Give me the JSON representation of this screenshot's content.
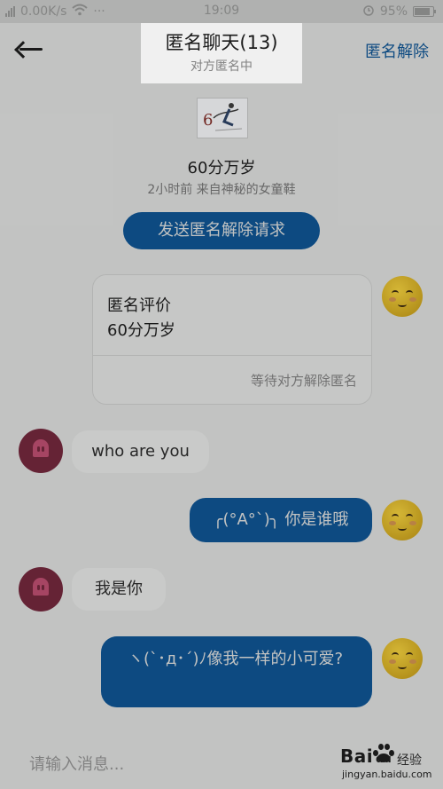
{
  "status_bar": {
    "network_speed": "0.00K/s",
    "time": "19:09",
    "battery_percent": "95%",
    "battery_level": 0.95,
    "more_dots": "···"
  },
  "header": {
    "title": "匿名聊天(13)",
    "subtitle": "对方匿名中",
    "right_action": "匿名解除"
  },
  "profile": {
    "name": "60分万岁",
    "meta": "2小时前  来自神秘的女童鞋",
    "image_text": "6"
  },
  "request_button": "发送匿名解除请求",
  "card": {
    "line1": "匿名评价",
    "line2": "60分万岁",
    "footer": "等待对方解除匿名"
  },
  "messages": [
    {
      "side": "in",
      "text": "who are you"
    },
    {
      "side": "out",
      "text": "╭(°A°`)╮ 你是谁哦"
    },
    {
      "side": "in",
      "text": "我是你"
    },
    {
      "side": "out",
      "text": "ヽ(`･д･´)ﾉ像我一样的小可爱?"
    }
  ],
  "composer": {
    "placeholder": "请输入消息..."
  },
  "watermark": {
    "brand": "Bai",
    "brand_suffix": "du",
    "product": "经验",
    "url": "jingyan.baidu.com"
  }
}
